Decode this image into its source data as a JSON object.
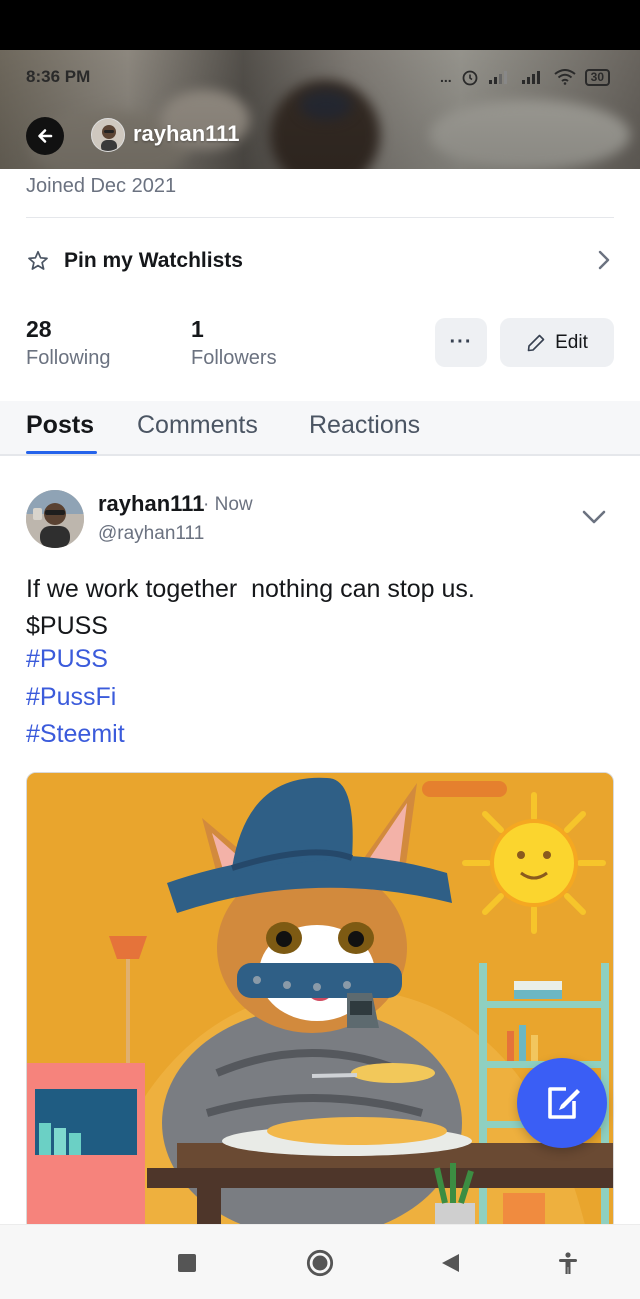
{
  "status_bar": {
    "time": "8:36 PM",
    "dots": "...",
    "battery": "30"
  },
  "header": {
    "username": "rayhan111",
    "icons": [
      "back-arrow-icon",
      "avatar"
    ]
  },
  "profile": {
    "joined": "Joined Dec 2021",
    "pin_watchlists_label": "Pin my Watchlists",
    "following": {
      "count": "28",
      "label": "Following"
    },
    "followers": {
      "count": "1",
      "label": "Followers"
    },
    "more_label": "···",
    "edit_label": "Edit"
  },
  "tabs": [
    {
      "label": "Posts",
      "active": true
    },
    {
      "label": "Comments",
      "active": false
    },
    {
      "label": "Reactions",
      "active": false
    }
  ],
  "post": {
    "author": "rayhan111",
    "time": "· Now",
    "handle": "@rayhan111",
    "text_line1": "If we work together  nothing can stop us.",
    "text_line2": "$PUSS",
    "hashtags": [
      "#PUSS",
      "#PussFi",
      "#Steemit"
    ],
    "image_alt": "cartoon cat in a blue hat eating at a table with a sun and shelves"
  },
  "colors": {
    "accent": "#3a5ef5",
    "hashtag": "#3b5bdb",
    "tab_underline": "#2563eb",
    "muted_text": "#6b7280",
    "image_background": "#e9a52d"
  },
  "navbar": {
    "icons": [
      "recents-square-icon",
      "home-circle-icon",
      "back-triangle-icon",
      "accessibility-icon"
    ]
  }
}
